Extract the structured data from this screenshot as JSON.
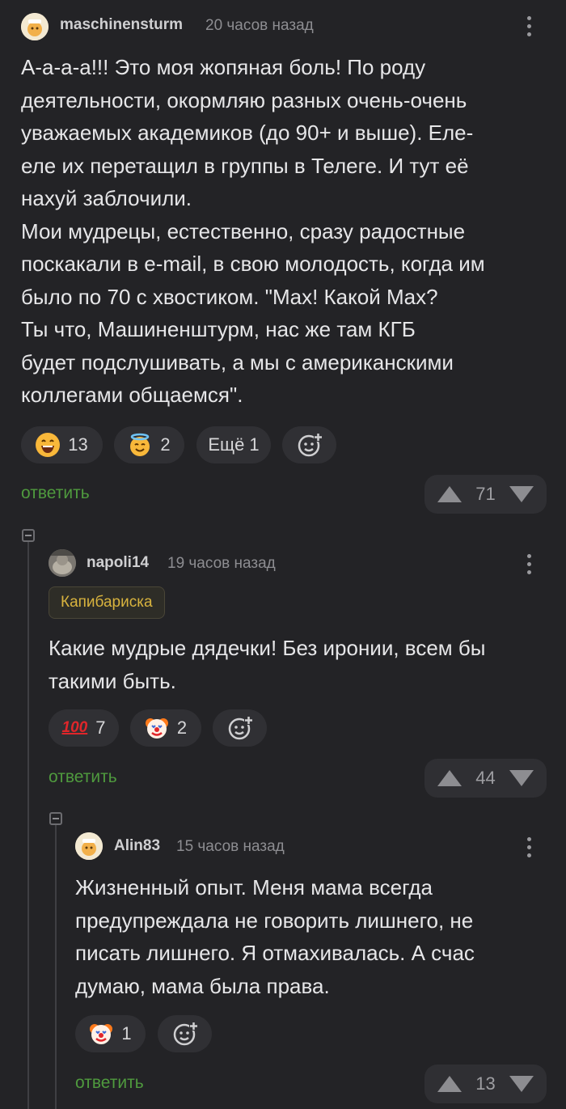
{
  "comments": [
    {
      "author": "maschinensturm",
      "time": "20 часов назад",
      "text": "А-а-а-а!!! Это моя жопяная боль! По роду\nдеятельности, окормляю разных очень-очень\nуважаемых академиков (до 90+ и выше). Еле-\nеле их перетащил в группы в Телеге. И тут её\nнахуй заблочили.\nМои мудрецы, естественно, сразу радостные\nпоскакали в e-mail, в свою молодость, когда им\nбыло по 70 с хвостиком. \"Max! Какой Max?\nТы что, Машиненштурм, нас же там КГБ\nбудет подслушивать, а мы с американскими\nколлегами общаемся\".",
      "reactions": [
        {
          "icon": "grinning-face-icon",
          "count": "13"
        },
        {
          "icon": "smiling-face-with-halo-icon",
          "count": "2"
        }
      ],
      "more_label": "Ещё 1",
      "reply_label": "ответить",
      "rating": "71"
    },
    {
      "author": "napoli14",
      "time": "19 часов назад",
      "badge": "Капибариска",
      "text": "Какие мудрые дядечки! Без иронии, всем бы\nтакими быть.",
      "reactions": [
        {
          "icon": "hundred-points-icon",
          "count": "7",
          "glyph": "100"
        },
        {
          "icon": "clown-face-icon",
          "count": "2"
        }
      ],
      "reply_label": "ответить",
      "rating": "44"
    },
    {
      "author": "Alin83",
      "time": "15 часов назад",
      "text": "Жизненный опыт. Меня мама всегда\nпредупреждала не говорить лишнего, не\nписать лишнего. Я отмахивалась. А счас\nдумаю, мама была права.",
      "reactions": [
        {
          "icon": "clown-face-icon",
          "count": "1"
        }
      ],
      "reply_label": "ответить",
      "rating": "13"
    }
  ],
  "colors": {
    "background": "#232326",
    "reply_green": "#4f9a3e",
    "badge_gold": "#d8b33e",
    "pill_bg": "#303034"
  }
}
